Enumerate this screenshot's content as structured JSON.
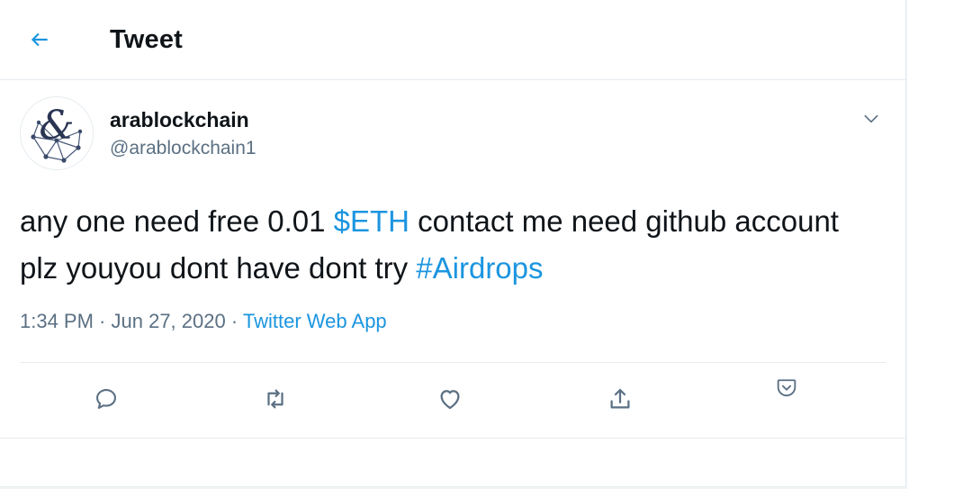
{
  "header": {
    "title": "Tweet",
    "back_icon": "arrow-left-icon"
  },
  "tweet": {
    "author": {
      "display_name": "arablockchain",
      "handle": "@arablockchain1"
    },
    "text": {
      "part1": "any one need free 0.01 ",
      "cashtag": "$ETH",
      "part2": " contact me need github account  plz youyou dont have dont try ",
      "hashtag": "#Airdrops"
    },
    "meta": {
      "time": "1:34 PM",
      "sep1": " · ",
      "date": "Jun 27, 2020",
      "sep2": " · ",
      "source": "Twitter Web App"
    },
    "actions": [
      "reply-icon",
      "retweet-icon",
      "like-icon",
      "share-icon",
      "analytics-icon"
    ]
  },
  "colors": {
    "link": "#1b95e0",
    "secondary_text": "#5b7083",
    "primary_text": "#0f1419",
    "border": "#e6ecf0"
  }
}
